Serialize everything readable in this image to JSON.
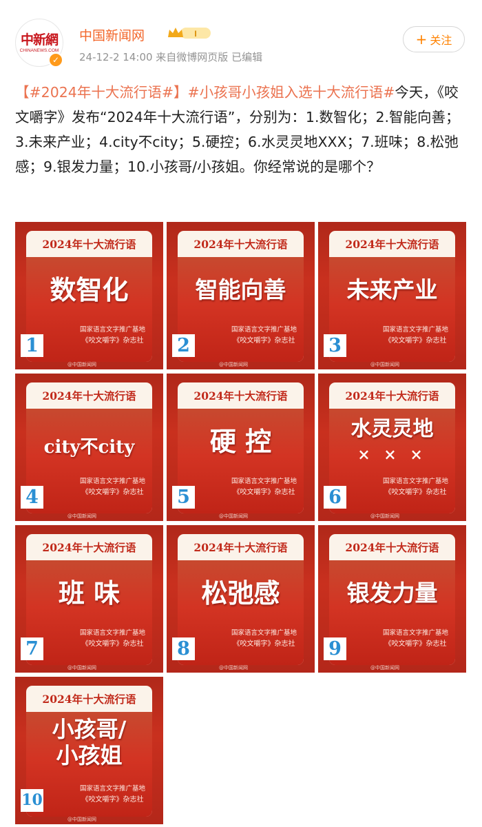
{
  "post": {
    "author": "中国新闻网",
    "level": "I",
    "meta": "24-12-2 14:00   来自微博网页版   已编辑",
    "follow_label": "关注",
    "avatar_text_cn": "中新網",
    "avatar_text_en": "CHINANEWS.COM",
    "text": {
      "hashtag1": "【#2024年十大流行语#】",
      "hashtag2": "#小孩哥小孩姐入选十大流行语#",
      "body": "今天，《咬文嚼字》发布“2024年十大流行语”，分别为：1.数智化；2.智能向善；3.未来产业；4.city不city；5.硬控；6.水灵灵地XXX；7.班味；8.松弛感；9.银发力量；10.小孩哥/小孩姐。你经常说的是哪个？"
    }
  },
  "cards": [
    {
      "header": "2024年十大流行语",
      "word": "数智化",
      "number": "1"
    },
    {
      "header": "2024年十大流行语",
      "word": "智能向善",
      "number": "2"
    },
    {
      "header": "2024年十大流行语",
      "word": "未来产业",
      "number": "3"
    },
    {
      "header": "2024年十大流行语",
      "word": "city不city",
      "number": "4"
    },
    {
      "header": "2024年十大流行语",
      "word": "硬 控",
      "number": "5"
    },
    {
      "header": "2024年十大流行语",
      "word": "水灵灵地",
      "sub": "× × ×",
      "number": "6"
    },
    {
      "header": "2024年十大流行语",
      "word": "班 味",
      "number": "7"
    },
    {
      "header": "2024年十大流行语",
      "word": "松弛感",
      "number": "8"
    },
    {
      "header": "2024年十大流行语",
      "word": "银发力量",
      "number": "9"
    },
    {
      "header": "2024年十大流行语",
      "word1": "小孩哥/",
      "word2": "小孩姐",
      "number": "10"
    }
  ],
  "card_common": {
    "org_line1": "国家语言文字推广基地",
    "org_line2": "《咬文嚼字》杂志社",
    "watermark": "@中国新闻网"
  },
  "colors": {
    "accent": "#f3662a",
    "hashtag": "#eb7350",
    "tile_red": "#c9301e",
    "number": "#2a8fd3"
  }
}
